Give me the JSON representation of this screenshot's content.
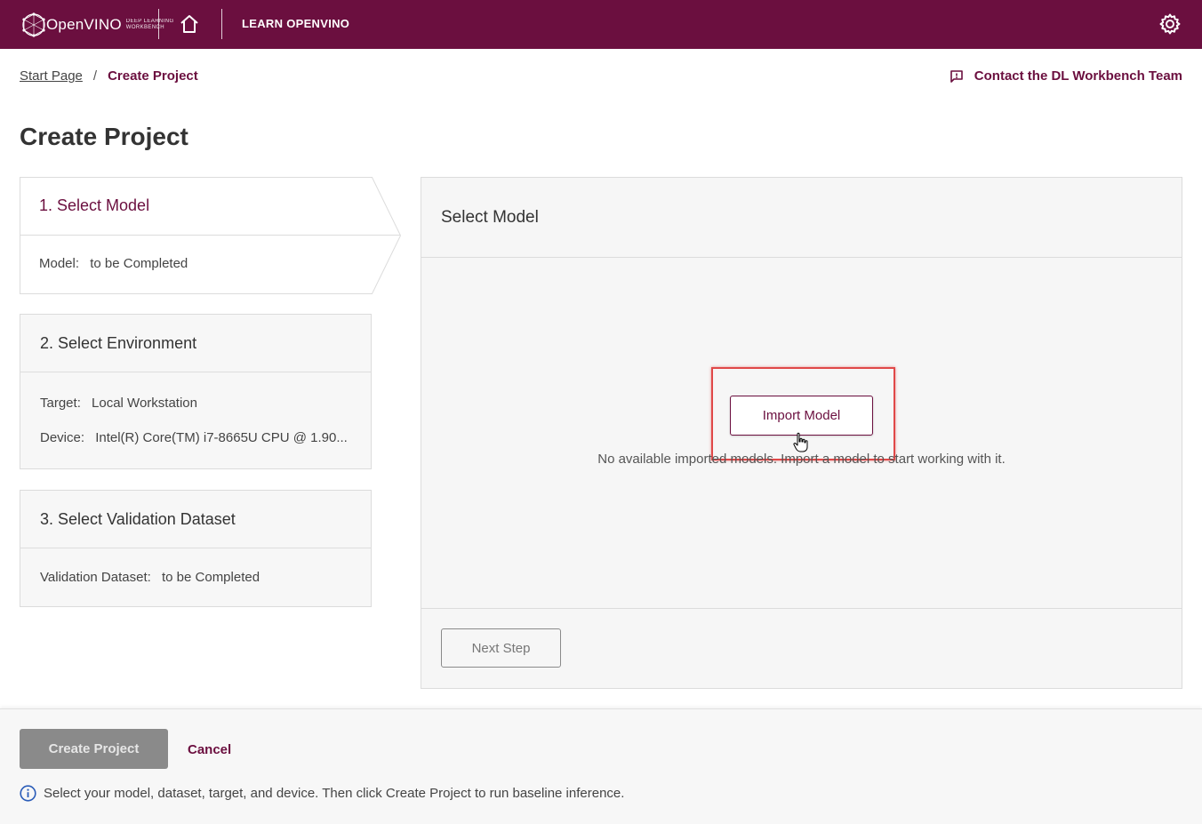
{
  "header": {
    "logo_text": "OpenVINO",
    "logo_sub_1": "DEEP LEARNING",
    "logo_sub_2": "WORKBENCH",
    "learn_label": "LEARN OPENVINO",
    "brand_color": "#6b0f3f"
  },
  "breadcrumb": {
    "start": "Start Page",
    "separator": "/",
    "current": "Create Project"
  },
  "contact_label": "Contact the DL Workbench Team",
  "page_title": "Create Project",
  "steps": [
    {
      "title": "1. Select Model",
      "rows": [
        {
          "label": "Model:",
          "value": "to be Completed"
        }
      ]
    },
    {
      "title": "2. Select Environment",
      "rows": [
        {
          "label": "Target:",
          "value": "Local Workstation"
        },
        {
          "label": "Device:",
          "value": "Intel(R) Core(TM) i7-8665U CPU @ 1.90..."
        }
      ]
    },
    {
      "title": "3. Select Validation Dataset",
      "rows": [
        {
          "label": "Validation Dataset:",
          "value": "to be Completed"
        }
      ]
    }
  ],
  "panel": {
    "title": "Select Model",
    "import_label": "Import Model",
    "empty_message": "No available imported models. Import a model to start working with it.",
    "next_label": "Next Step"
  },
  "footer": {
    "create_label": "Create Project",
    "cancel_label": "Cancel",
    "hint": "Select your model, dataset, target, and device. Then click Create Project to run baseline inference."
  },
  "icons": {
    "home": "home-icon",
    "settings": "gear-icon",
    "contact": "feedback-icon",
    "info": "info-icon"
  }
}
